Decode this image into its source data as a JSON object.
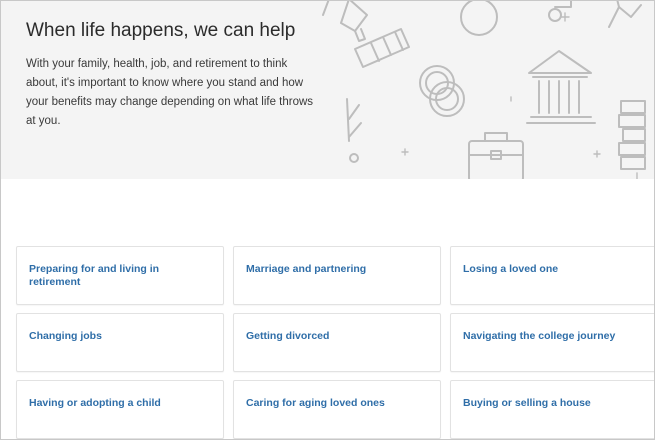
{
  "hero": {
    "title": "When life happens, we can help",
    "description": "With your family, health, job, and retirement to think about, it's important to know where you stand and how your benefits may change depending on what life throws at you."
  },
  "life_events": [
    {
      "label": "Preparing for and living in retirement"
    },
    {
      "label": "Marriage and partnering"
    },
    {
      "label": "Losing a loved one"
    },
    {
      "label": "Changing jobs"
    },
    {
      "label": "Getting divorced"
    },
    {
      "label": "Navigating the college journey"
    },
    {
      "label": "Having or adopting a child"
    },
    {
      "label": "Caring for aging loved ones"
    },
    {
      "label": "Buying or selling a house"
    }
  ],
  "colors": {
    "link": "#2f6ea8",
    "hero_background": "#f4f4f4",
    "text": "#2b2b2b"
  },
  "icons": [
    "tie-icon",
    "rings-icon",
    "bank-icon",
    "briefcase-icon",
    "books-icon",
    "sparkle-icon"
  ]
}
